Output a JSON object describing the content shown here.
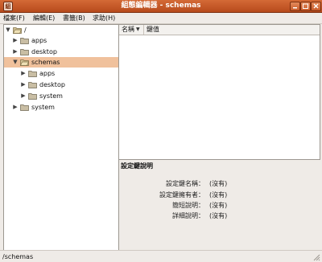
{
  "window": {
    "title": "組態編輯器 - schemas",
    "app_icon_glyph": "組",
    "accent_color": "#c85c2b"
  },
  "menubar": {
    "items": [
      "檔案(F)",
      "編輯(E)",
      "書籤(B)",
      "求助(H)"
    ]
  },
  "tree": {
    "root": "/",
    "items": [
      {
        "label": "apps",
        "icon": "folder-icon",
        "expanded": false
      },
      {
        "label": "desktop",
        "icon": "folder-icon",
        "expanded": false
      },
      {
        "label": "schemas",
        "icon": "folder-open-icon",
        "expanded": true,
        "selected": true
      },
      {
        "label": "apps",
        "icon": "folder-icon",
        "expanded": false
      },
      {
        "label": "desktop",
        "icon": "folder-icon",
        "expanded": false
      },
      {
        "label": "system",
        "icon": "folder-icon",
        "expanded": false
      },
      {
        "label": "system",
        "icon": "folder-icon",
        "expanded": false
      }
    ],
    "selected_color": "#f0c19c"
  },
  "list": {
    "columns": [
      "名稱",
      "鍵值"
    ],
    "rows": []
  },
  "details": {
    "title": "設定鍵說明",
    "fields": [
      {
        "label": "設定鍵名稱：",
        "value": "(沒有)"
      },
      {
        "label": "設定鍵擁有者：",
        "value": "(沒有)"
      },
      {
        "label": "簡短說明：",
        "value": "(沒有)"
      },
      {
        "label": "詳細說明：",
        "value": "(沒有)"
      }
    ]
  },
  "status": {
    "path": "/schemas"
  }
}
